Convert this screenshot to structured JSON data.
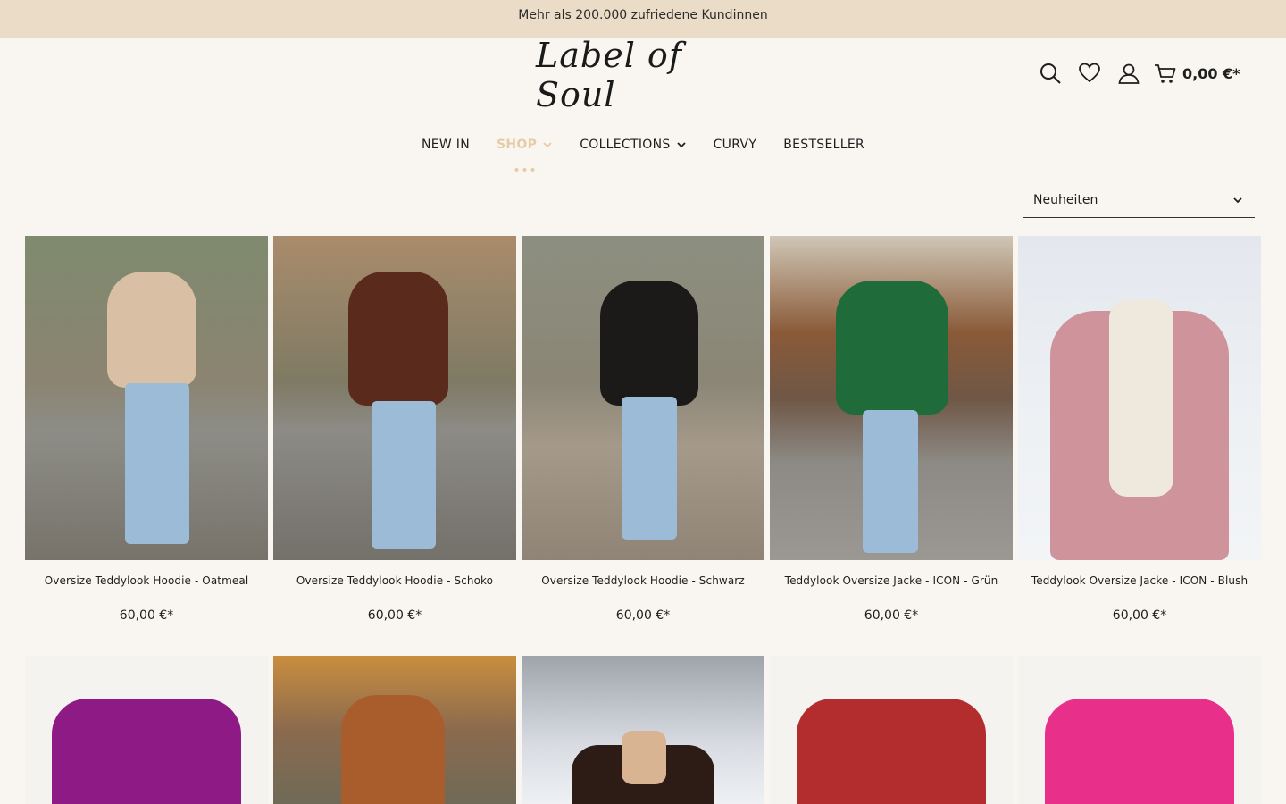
{
  "announcement": "Mehr als 200.000 zufriedene Kundinnen",
  "brand": {
    "logo_text": "Label of Soul"
  },
  "header": {
    "icons": [
      "search-icon",
      "heart-icon",
      "user-icon",
      "cart-icon"
    ],
    "cart_total": "0,00 €*"
  },
  "nav": {
    "items": [
      {
        "label": "NEW IN"
      },
      {
        "label": "SHOP"
      },
      {
        "label": "COLLECTIONS"
      },
      {
        "label": "CURVY"
      },
      {
        "label": "BESTSELLER"
      }
    ]
  },
  "sort": {
    "selected": "Neuheiten"
  },
  "products": [
    {
      "name": "Oversize Teddylook Hoodie - Oatmeal",
      "price": "60,00 €*",
      "color": "#d9c0a4"
    },
    {
      "name": "Oversize Teddylook Hoodie - Schoko",
      "price": "60,00 €*",
      "color": "#5a2a1c"
    },
    {
      "name": "Oversize Teddylook Hoodie - Schwarz",
      "price": "60,00 €*",
      "color": "#1b1a19"
    },
    {
      "name": "Teddylook Oversize Jacke - ICON - Grün",
      "price": "60,00 €*",
      "color": "#1f6b3a"
    },
    {
      "name": "Teddylook Oversize Jacke - ICON - Blush",
      "price": "60,00 €*",
      "color": "#cf949b"
    }
  ],
  "products_row2": [
    {
      "color": "#8e1a86"
    },
    {
      "color": "#a95d2c"
    },
    {
      "color": "#2d1c16"
    },
    {
      "color": "#b32c2e"
    },
    {
      "color": "#e8308a"
    }
  ]
}
